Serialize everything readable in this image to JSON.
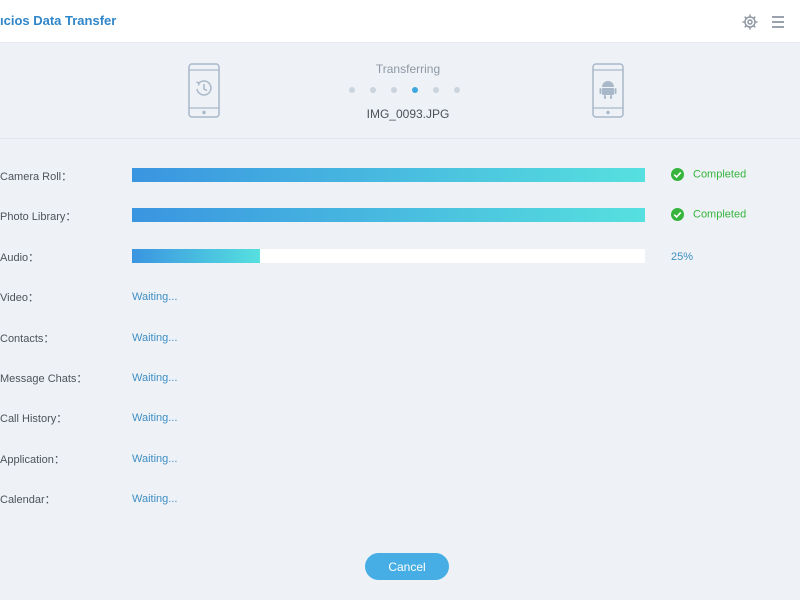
{
  "app": {
    "title": "ıcios Data Transfer"
  },
  "toolbar": {
    "settings_icon": "gear-icon",
    "menu_icon": "hamburger-menu-icon"
  },
  "transfer": {
    "status_label": "Transferring",
    "current_file": "IMG_0093.JPG",
    "step_count": 6,
    "active_step": 4,
    "source_device_icon": "phone-backup-icon",
    "target_device_icon": "phone-android-icon"
  },
  "categories": [
    {
      "label": "Camera Roll：",
      "state": "completed",
      "progress": 1.0,
      "status_text": "Completed"
    },
    {
      "label": "Photo Library：",
      "state": "completed",
      "progress": 1.0,
      "status_text": "Completed"
    },
    {
      "label": "Audio：",
      "state": "in-progress",
      "progress": 0.25,
      "status_text": "25%"
    },
    {
      "label": "Video：",
      "state": "waiting",
      "status_text": "Waiting..."
    },
    {
      "label": "Contacts：",
      "state": "waiting",
      "status_text": "Waiting..."
    },
    {
      "label": "Message Chats：",
      "state": "waiting",
      "status_text": "Waiting..."
    },
    {
      "label": "Call History：",
      "state": "waiting",
      "status_text": "Waiting..."
    },
    {
      "label": "Application：",
      "state": "waiting",
      "status_text": "Waiting..."
    },
    {
      "label": "Calendar：",
      "state": "waiting",
      "status_text": "Waiting..."
    }
  ],
  "footer": {
    "cancel_label": "Cancel"
  },
  "colors": {
    "accent": "#46aee4",
    "progress_start": "#3a95e0",
    "progress_end": "#56e0df",
    "completed": "#36b43c",
    "waiting": "#3f8ec3",
    "title": "#2f86c9"
  }
}
